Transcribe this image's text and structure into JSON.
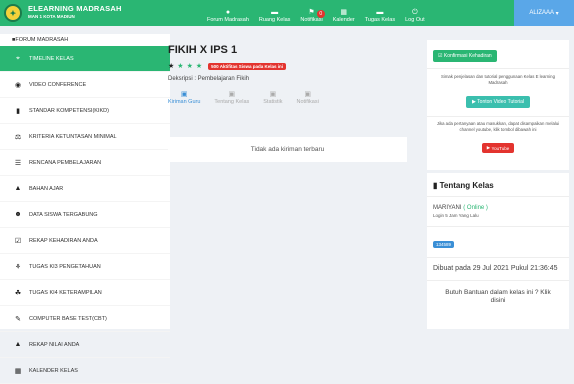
{
  "brand": {
    "title": "ELEARNING MADRASAH",
    "subtitle": "MAN 1 KOTA MADIUN"
  },
  "topnav": [
    {
      "label": "Forum Madrasah",
      "icon": "chat-icon"
    },
    {
      "label": "Ruang Kelas",
      "icon": "monitor-icon"
    },
    {
      "label": "Notifikasi",
      "icon": "bell-icon",
      "badge": "0"
    },
    {
      "label": "Kalender",
      "icon": "calendar-icon"
    },
    {
      "label": "Tugas Kelas",
      "icon": "folder-icon"
    },
    {
      "label": "Log Out",
      "icon": "power-icon"
    }
  ],
  "user": {
    "name": "ALIZAAA"
  },
  "sidebar": {
    "items": [
      {
        "label": "FORUM MADRASAH",
        "icon": "forum-icon"
      },
      {
        "label": "TIMELINE KELAS",
        "icon": "rss-icon",
        "active": true
      },
      {
        "label": "VIDEO CONFERENCE",
        "icon": "camera-icon"
      },
      {
        "label": "STANDAR KOMPETENSI(KIKD)",
        "icon": "book-icon"
      },
      {
        "label": "KRITERIA KETUNTASAN MINIMAL",
        "icon": "balance-icon"
      },
      {
        "label": "RENCANA PEMBELAJARAN",
        "icon": "list-icon"
      },
      {
        "label": "BAHAN AJAR",
        "icon": "folder-open-icon"
      },
      {
        "label": "DATA SISWA TERGABUNG",
        "icon": "users-icon"
      },
      {
        "label": "REKAP KEHADIRAN ANDA",
        "icon": "checkbox-icon"
      },
      {
        "label": "TUGAS KI3 PENGETAHUAN",
        "icon": "brain-icon"
      },
      {
        "label": "TUGAS KI4 KETERAMPILAN",
        "icon": "skill-icon"
      },
      {
        "label": "COMPUTER BASE TEST(CBT)",
        "icon": "edit-icon"
      },
      {
        "label": "REKAP NILAI ANDA",
        "icon": "graduation-icon"
      },
      {
        "label": "KALENDER KELAS",
        "icon": "calendar-icon"
      }
    ]
  },
  "main": {
    "title": "FIKIH X IPS 1",
    "activity": "500 Aktifitas Siswa pada Kelas ini",
    "description": "Deksripsi : Pembelajaran Fikih",
    "tabs": [
      {
        "label": "Kiriman Guru",
        "active": true
      },
      {
        "label": "Tentang Kelas"
      },
      {
        "label": "Statistik"
      },
      {
        "label": "Notifikasi"
      }
    ],
    "empty": "Tidak ada kiriman terbaru"
  },
  "right": {
    "confirm_btn": "Konfirmasi Kehadiran",
    "tutorial_text": "Simak penjelasan dan tutorial penggunaan Kelas E learning Madrasah",
    "tutorial_btn": "Tonton Video Tutorial",
    "question_text": "Jika ada pertanyaan atau masukkan, dapat disampaikan melalui channel youtube, klik tombol dibawah ini",
    "youtube_btn": "YouTube",
    "about_title": "Tentang Kelas",
    "owner_name": "MARIYANI",
    "owner_status": "( Online )",
    "last_login": "Login 5 Jam Yang Lalu",
    "class_code": "134589",
    "created": "Dibuat pada 29 Jul 2021 Pukul 21:36:45",
    "help": "Butuh Bantuan dalam kelas ini ? Klik disini"
  },
  "colors": {
    "primary": "#2ab673",
    "accent": "#3a8fd6",
    "danger": "#e3342f"
  }
}
